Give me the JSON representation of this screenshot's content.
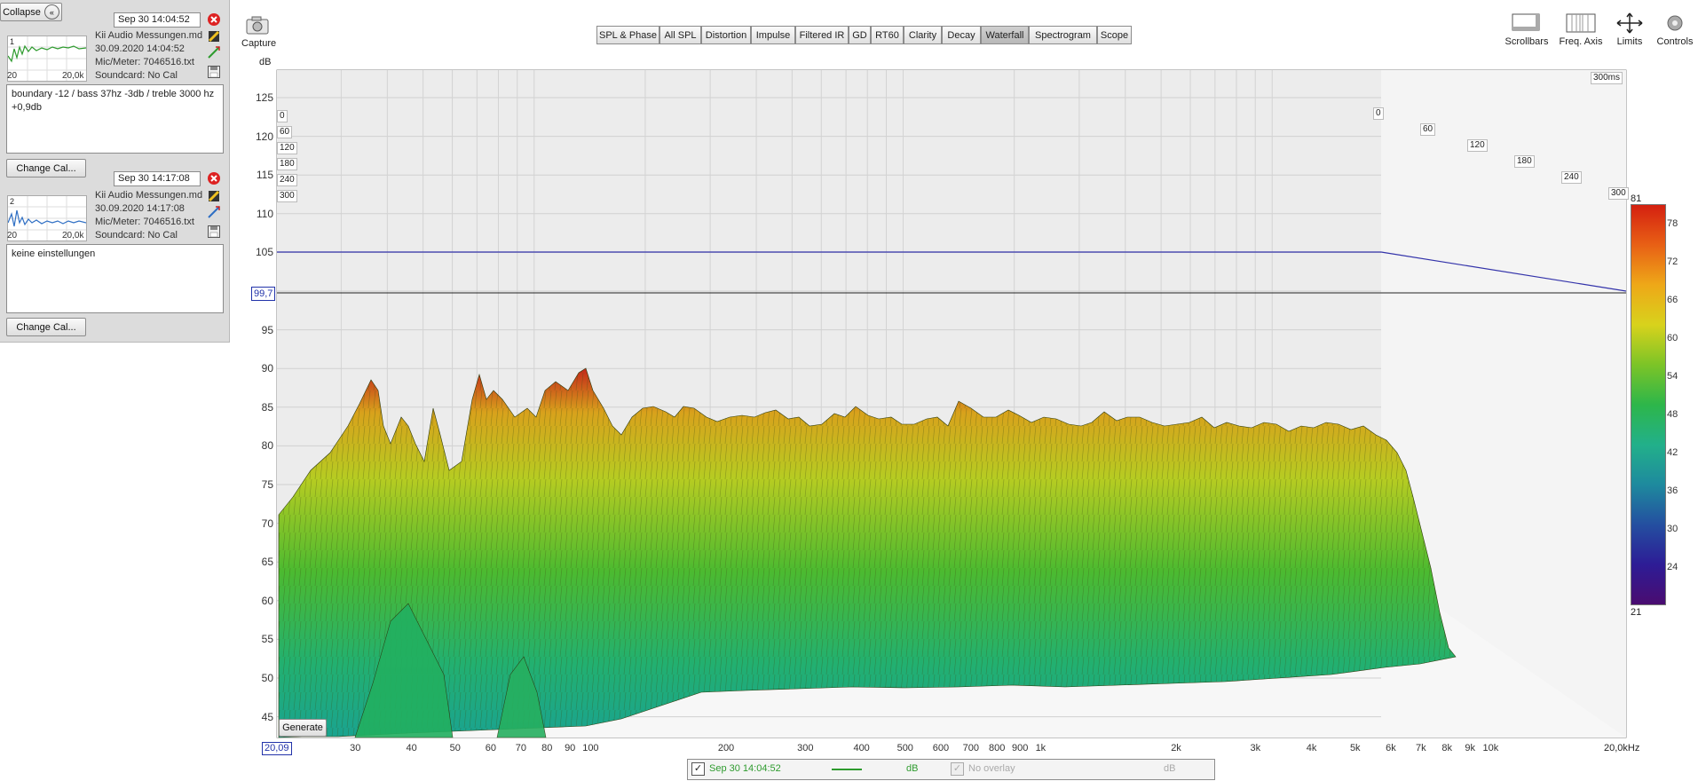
{
  "left": {
    "collapse_label": "Collapse",
    "measurements": [
      {
        "date": "Sep 30 14:04:52",
        "index": "1",
        "file": "Kii Audio Messungen.md",
        "datetime": "30.09.2020 14:04:52",
        "mic": "Mic/Meter: 7046516.txt",
        "soundcard": "Soundcard: No Cal",
        "thumb_min": "20",
        "thumb_max": "20,0k",
        "notes": "boundary -12 / bass 37hz -3db / treble 3000 hz +0,9db",
        "change_cal": "Change Cal...",
        "color": "#2e9b2e"
      },
      {
        "date": "Sep 30 14:17:08",
        "index": "2",
        "file": "Kii Audio Messungen.md",
        "datetime": "30.09.2020 14:17:08",
        "mic": "Mic/Meter: 7046516.txt",
        "soundcard": "Soundcard: No Cal",
        "thumb_min": "20",
        "thumb_max": "20,0k",
        "notes": "keine einstellungen",
        "change_cal": "Change Cal...",
        "color": "#2f6fc4"
      }
    ]
  },
  "capture_label": "Capture",
  "tabs": [
    "SPL & Phase",
    "All SPL",
    "Distortion",
    "Impulse",
    "Filtered IR",
    "GD",
    "RT60",
    "Clarity",
    "Decay",
    "Waterfall",
    "Spectrogram",
    "Scope"
  ],
  "active_tab": "Waterfall",
  "tools": [
    "Scrollbars",
    "Freq. Axis",
    "Limits",
    "Controls"
  ],
  "plot": {
    "y_unit": "dB",
    "y_ticks": [
      "125",
      "120",
      "115",
      "110",
      "105",
      "100",
      "95",
      "90",
      "85",
      "80",
      "75",
      "70",
      "65",
      "60",
      "55",
      "50",
      "45"
    ],
    "cursor_value": "99,7",
    "x_start": "20,09",
    "x_ticks": [
      "30",
      "40",
      "50",
      "60",
      "70",
      "80",
      "90",
      "100",
      "200",
      "300",
      "400",
      "500",
      "600",
      "700",
      "800",
      "900",
      "1k",
      "2k",
      "3k",
      "4k",
      "5k",
      "6k",
      "7k",
      "8k",
      "9k",
      "10k"
    ],
    "x_end": "20,0kHz",
    "time_max": "300ms",
    "time_ticks_left": [
      "0",
      "60",
      "120",
      "180",
      "240",
      "300"
    ],
    "time_ticks_right": [
      "0",
      "60",
      "120",
      "180",
      "240",
      "300"
    ],
    "generate_label": "Generate"
  },
  "colorbar": {
    "top": "81",
    "bottom": "21",
    "ticks": [
      "78",
      "72",
      "66",
      "60",
      "54",
      "48",
      "42",
      "36",
      "30",
      "24"
    ],
    "colors": [
      "#d42010",
      "#e86015",
      "#eea818",
      "#d8d21c",
      "#7cc427",
      "#2db64a",
      "#22b08a",
      "#1e8a9e",
      "#244fa0",
      "#2d1c96",
      "#4a0c70"
    ]
  },
  "legend": {
    "trace": "Sep 30 14:04:52",
    "unit": "dB",
    "overlay": "No overlay",
    "overlay_unit": "dB"
  }
}
